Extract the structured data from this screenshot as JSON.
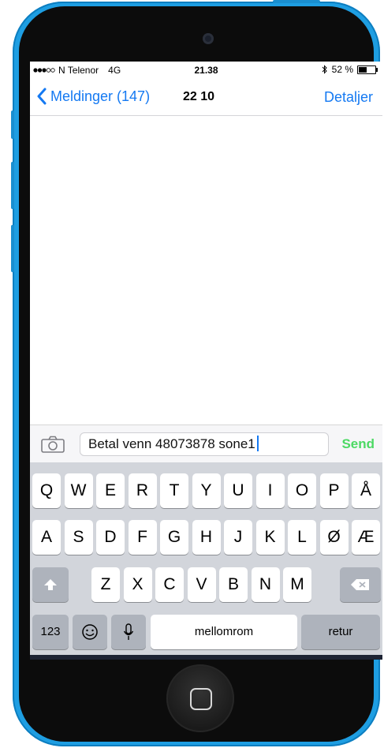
{
  "status_bar": {
    "carrier": "N Telenor",
    "network": "4G",
    "time": "21.38",
    "battery": "52 %",
    "battery_level": 0.52
  },
  "nav": {
    "back_label": "Meldinger (147)",
    "title": "22 10",
    "details_label": "Detaljer"
  },
  "composer": {
    "message_text": "Betal venn 48073878 sone1",
    "send_label": "Send"
  },
  "keyboard": {
    "row1": [
      "Q",
      "W",
      "E",
      "R",
      "T",
      "Y",
      "U",
      "I",
      "O",
      "P",
      "Å"
    ],
    "row2": [
      "A",
      "S",
      "D",
      "F",
      "G",
      "H",
      "J",
      "K",
      "L",
      "Ø",
      "Æ"
    ],
    "row3": [
      "Z",
      "X",
      "C",
      "V",
      "B",
      "N",
      "M"
    ],
    "numbers_label": "123",
    "space_label": "mellomrom",
    "return_label": "retur"
  },
  "colors": {
    "phone_body": "#1e9ee2",
    "ios_blue": "#1479f2",
    "send_green": "#4cd964",
    "keyboard_bg": "#d2d5db"
  },
  "icons": [
    "chevron-left-icon",
    "camera-icon",
    "shift-icon",
    "delete-icon",
    "emoji-icon",
    "microphone-icon",
    "bluetooth-icon",
    "battery-icon",
    "home-button-icon"
  ]
}
